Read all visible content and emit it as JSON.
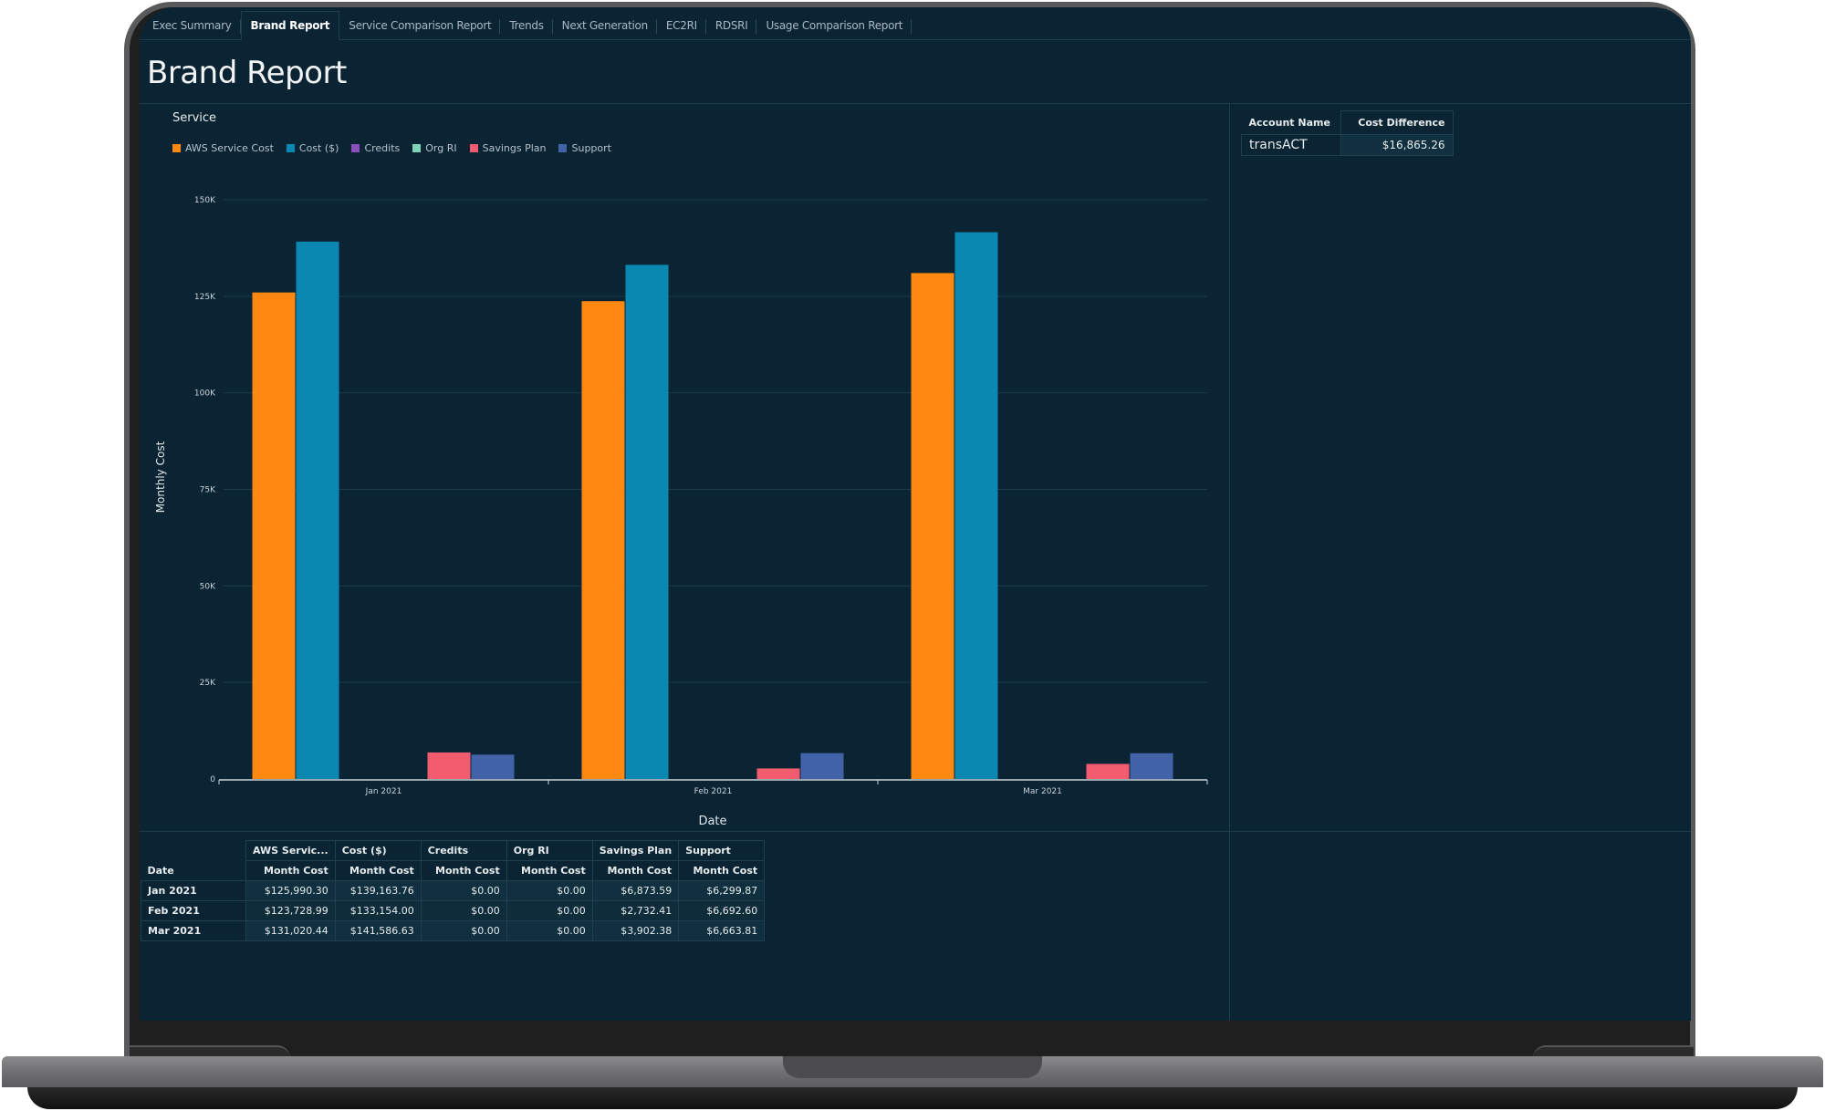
{
  "tabs": [
    {
      "label": "Exec Summary",
      "active": false
    },
    {
      "label": "Brand Report",
      "active": true
    },
    {
      "label": "Service Comparison Report",
      "active": false
    },
    {
      "label": "Trends",
      "active": false
    },
    {
      "label": "Next Generation",
      "active": false
    },
    {
      "label": "EC2RI",
      "active": false
    },
    {
      "label": "RDSRI",
      "active": false
    },
    {
      "label": "Usage Comparison Report",
      "active": false
    }
  ],
  "page_title": "Brand Report",
  "chart_section_label": "Service",
  "chart_data": {
    "type": "bar",
    "title": "Service",
    "xlabel": "Date",
    "ylabel": "Monthly Cost",
    "categories": [
      "Jan 2021",
      "Feb 2021",
      "Mar 2021"
    ],
    "ylim": [
      0,
      150000
    ],
    "yticks": [
      0,
      25000,
      50000,
      75000,
      100000,
      125000,
      150000
    ],
    "ytick_labels": [
      "0",
      "25K",
      "50K",
      "75K",
      "100K",
      "125K",
      "150K"
    ],
    "grid": true,
    "legend_position": "top-left",
    "series": [
      {
        "name": "AWS Service Cost",
        "color": "#ff8810",
        "values": [
          125990.3,
          123728.99,
          131020.44
        ]
      },
      {
        "name": "Cost ($)",
        "color": "#0a88b2",
        "values": [
          139163.76,
          133154.0,
          141586.63
        ]
      },
      {
        "name": "Credits",
        "color": "#8c4fbc",
        "values": [
          0,
          0,
          0
        ]
      },
      {
        "name": "Org RI",
        "color": "#7ed3b8",
        "values": [
          0,
          0,
          0
        ]
      },
      {
        "name": "Savings Plan",
        "color": "#f25c6e",
        "values": [
          6873.59,
          2732.41,
          3902.38
        ]
      },
      {
        "name": "Support",
        "color": "#4263a8",
        "values": [
          6299.87,
          6692.6,
          6663.81
        ]
      }
    ]
  },
  "account_table": {
    "headers": [
      "Account Name",
      "Cost Difference"
    ],
    "rows": [
      [
        "transACT",
        "$16,865.26"
      ]
    ]
  },
  "pivot_table": {
    "row_header": "Date",
    "groups": [
      "AWS Servic...",
      "Cost ($)",
      "Credits",
      "Org RI",
      "Savings Plan",
      "Support"
    ],
    "sub_header": "Month Cost",
    "rows": [
      {
        "date": "Jan 2021",
        "values": [
          "$125,990.30",
          "$139,163.76",
          "$0.00",
          "$0.00",
          "$6,873.59",
          "$6,299.87"
        ]
      },
      {
        "date": "Feb 2021",
        "values": [
          "$123,728.99",
          "$133,154.00",
          "$0.00",
          "$0.00",
          "$2,732.41",
          "$6,692.60"
        ]
      },
      {
        "date": "Mar 2021",
        "values": [
          "$131,020.44",
          "$141,586.63",
          "$0.00",
          "$0.00",
          "$3,902.38",
          "$6,663.81"
        ]
      }
    ]
  }
}
